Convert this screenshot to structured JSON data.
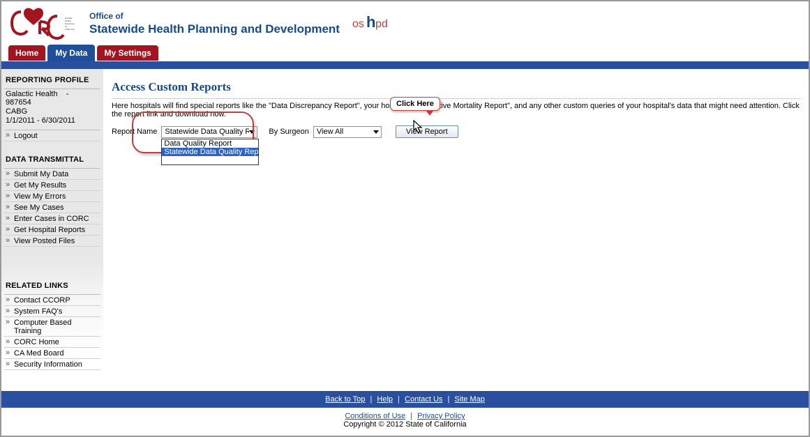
{
  "header": {
    "logo_text": "CORC",
    "logo_tag": "Cardiac Online Reporting for California",
    "office": "Office of",
    "title": "Statewide Health Planning and Development",
    "oshpd": "oshpd"
  },
  "tabs": {
    "home": "Home",
    "mydata": "My Data",
    "settings": "My Settings"
  },
  "sidebar": {
    "profile_title": "REPORTING PROFILE",
    "hospital": "Galactic Health",
    "sep": "-",
    "facility_id": "987654",
    "program": "CABG",
    "period": "1/1/2011 - 6/30/2011",
    "logout": "Logout",
    "transmit_title": "DATA TRANSMITTAL",
    "transmit": [
      "Submit My Data",
      "Get My Results",
      "View My Errors",
      "See My Cases",
      "Enter Cases in CORC",
      "Get Hospital Reports",
      "View Posted Files"
    ],
    "related_title": "RELATED LINKS",
    "related": [
      "Contact CCORP",
      "System FAQ's",
      "Computer Based Training",
      "CORC Home",
      "CA Med Board",
      "Security Information"
    ]
  },
  "main": {
    "heading": "Access Custom Reports",
    "intro": "Here hospitals will find special reports like the \"Data Discrepancy Report\", your hospital's \"Operative Mortality Report\", and any other custom queries of your hospital's data that might need attention. Click the report link and download now.",
    "callout": "Click Here",
    "filters": {
      "report_label": "Report Name",
      "report_selected": "Statewide Data Quality Report",
      "report_options": [
        "Data Quality Report",
        "Statewide Data Quality Report",
        ""
      ],
      "surgeon_label": "By Surgeon",
      "surgeon_selected": "View All",
      "view_btn": "View Report"
    }
  },
  "footer": {
    "back": "Back to Top",
    "help": "Help",
    "contact": "Contact Us",
    "sitemap": "Site Map",
    "conditions": "Conditions of Use",
    "privacy": "Privacy Policy",
    "copyright_prefix": "Copyright © ",
    "year": "2012",
    "owner": " State of California"
  }
}
